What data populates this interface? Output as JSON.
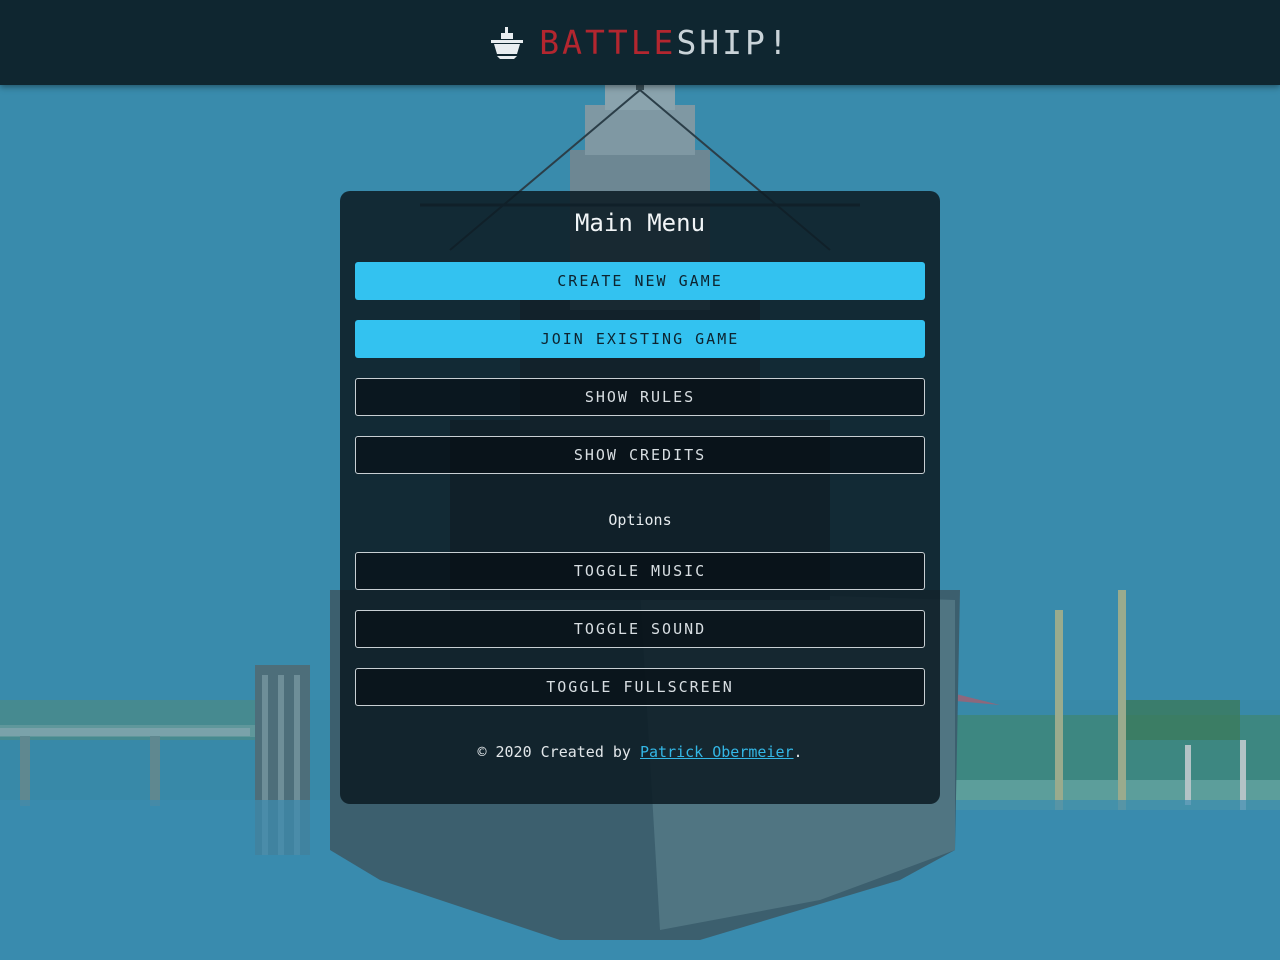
{
  "header": {
    "logo_icon": "battleship-icon",
    "title_red": "BATTLE",
    "title_white": "SHIP!",
    "colors": {
      "red": "#b3262f",
      "white": "#c9d3d8",
      "bar": "#0f2630"
    }
  },
  "menu": {
    "title": "Main Menu",
    "create_label": "CREATE NEW GAME",
    "join_label": "JOIN EXISTING GAME",
    "rules_label": "SHOW RULES",
    "credits_label": "SHOW CREDITS",
    "options_heading": "Options",
    "music_label": "TOGGLE MUSIC",
    "sound_label": "TOGGLE SOUND",
    "fullscreen_label": "TOGGLE FULLSCREEN"
  },
  "footer": {
    "prefix": "© 2020 Created by ",
    "author": "Patrick Obermeier",
    "suffix": "."
  },
  "colors": {
    "primary_button": "#33c2f0",
    "link": "#33b7e6",
    "panel": "#0d1c24"
  },
  "background": {
    "description_icon": "battleship-photo-background"
  }
}
